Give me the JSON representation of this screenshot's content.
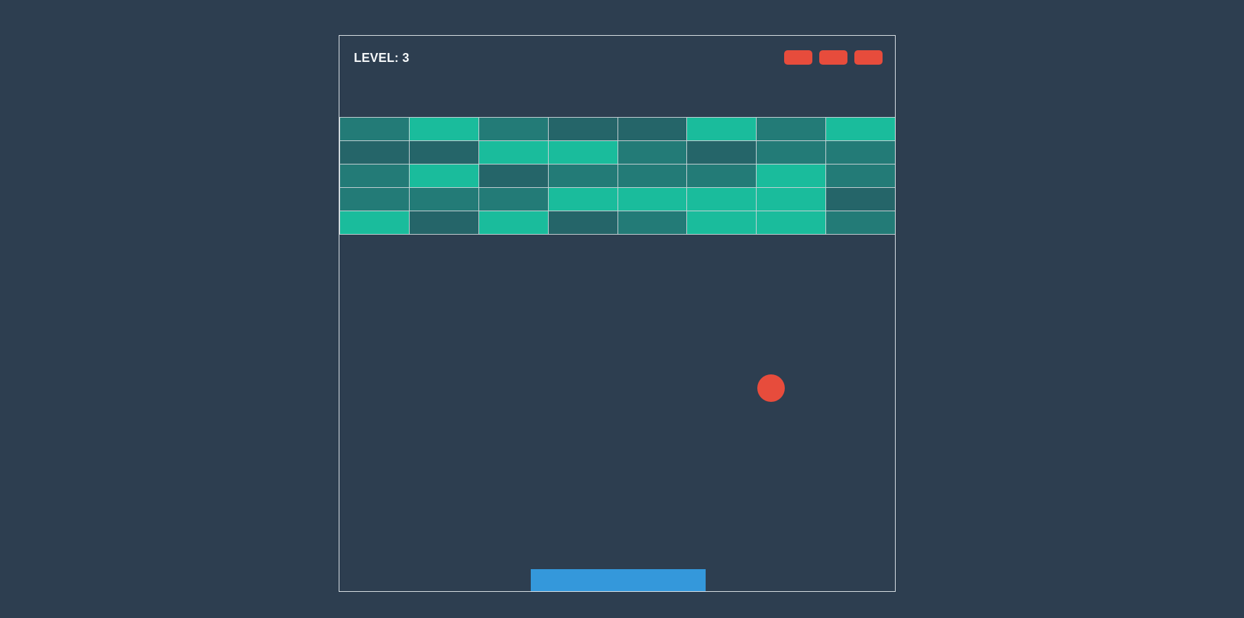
{
  "hud": {
    "level_text": "LEVEL: 3",
    "lives": 3
  },
  "colors": {
    "background": "#2d3e50",
    "board_border": "#dfe6ea",
    "brick_bright": "#1abc9c",
    "brick_medium": "#237b77",
    "brick_dark": "#256569",
    "ball": "#e74c3c",
    "paddle": "#3498db",
    "life": "#e74c3c"
  },
  "bricks": {
    "columns": 8,
    "rows": [
      [
        "medium",
        "bright",
        "medium",
        "dark",
        "dark",
        "bright",
        "medium",
        "bright"
      ],
      [
        "dark",
        "dark",
        "bright",
        "bright",
        "medium",
        "dark",
        "medium",
        "medium"
      ],
      [
        "medium",
        "bright",
        "dark",
        "medium",
        "medium",
        "medium",
        "bright",
        "medium"
      ],
      [
        "medium",
        "medium",
        "medium",
        "bright",
        "bright",
        "bright",
        "bright",
        "dark"
      ],
      [
        "bright",
        "dark",
        "bright",
        "dark",
        "medium",
        "bright",
        "bright",
        "medium"
      ]
    ]
  }
}
